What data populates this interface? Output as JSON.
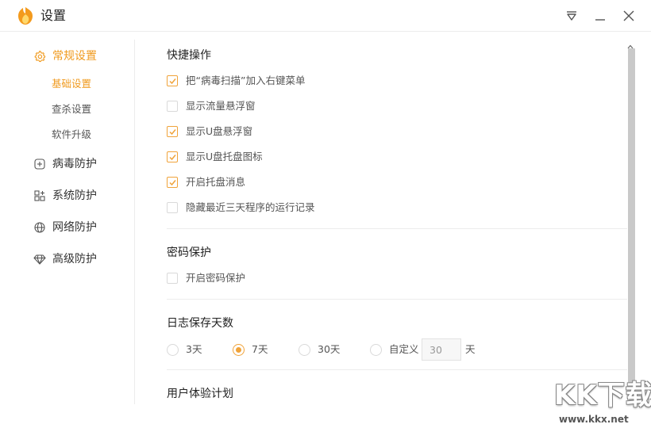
{
  "window": {
    "title": "设置",
    "icons": {
      "logo": "flame-shield-logo",
      "menu": "dropdown-menu-icon",
      "minimize": "minimize-icon",
      "close": "close-icon"
    }
  },
  "sidebar": {
    "groups": [
      {
        "label": "常规设置",
        "icon": "gear-icon",
        "active": true,
        "items": [
          {
            "label": "基础设置",
            "active": true
          },
          {
            "label": "查杀设置",
            "active": false
          },
          {
            "label": "软件升级",
            "active": false
          }
        ]
      },
      {
        "label": "病毒防护",
        "icon": "plus-square-icon",
        "active": false
      },
      {
        "label": "系统防护",
        "icon": "grid-icon",
        "active": false
      },
      {
        "label": "网络防护",
        "icon": "globe-icon",
        "active": false
      },
      {
        "label": "高级防护",
        "icon": "diamond-icon",
        "active": false
      }
    ]
  },
  "content": {
    "quick_ops": {
      "title": "快捷操作",
      "options": [
        {
          "label": "把“病毒扫描”加入右键菜单",
          "checked": true
        },
        {
          "label": "显示流量悬浮窗",
          "checked": false
        },
        {
          "label": "显示U盘悬浮窗",
          "checked": true
        },
        {
          "label": "显示U盘托盘图标",
          "checked": true
        },
        {
          "label": "开启托盘消息",
          "checked": true
        },
        {
          "label": "隐藏最近三天程序的运行记录",
          "checked": false
        }
      ]
    },
    "password": {
      "title": "密码保护",
      "options": [
        {
          "label": "开启密码保护",
          "checked": false
        }
      ]
    },
    "log_days": {
      "title": "日志保存天数",
      "options": [
        {
          "label": "3天",
          "selected": false
        },
        {
          "label": "7天",
          "selected": true
        },
        {
          "label": "30天",
          "selected": false
        },
        {
          "label": "自定义",
          "selected": false
        }
      ],
      "custom_value": "30",
      "custom_unit": "天"
    },
    "ux_plan": {
      "title": "用户体验计划"
    }
  },
  "watermark": {
    "text": "KK下载",
    "url": "www.kkx.net"
  },
  "colors": {
    "accent": "#f09a1e",
    "check": "#f0a33a",
    "divider": "#ececec",
    "scrollbar": "#c9c9c9"
  }
}
